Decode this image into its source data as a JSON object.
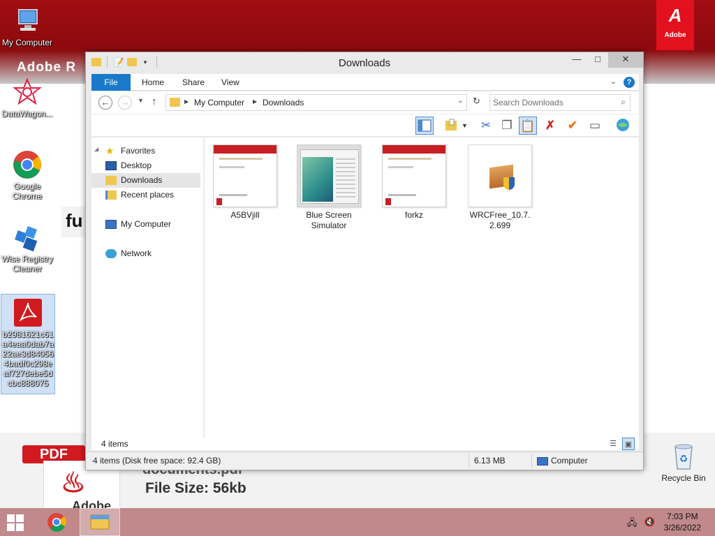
{
  "desktop": {
    "wallpaper": {
      "adobe_text": "Adobe R",
      "adobe_logo_text": "Adobe",
      "fu_text": "fu",
      "pdf_badge": "PDF",
      "pdf_doc_brand": "Adobe",
      "doc_name": "documents.pdf",
      "file_size": "File Size: 56kb"
    },
    "icons": [
      {
        "label": "My Computer"
      },
      {
        "label": "DataWagon..."
      },
      {
        "label": "Google Chrome"
      },
      {
        "label": "Wise Registry Cleaner"
      },
      {
        "label": "b2981621c61a4eaa0dab7a22ae3d840564badf0c298eaf727debe5dcbc888075"
      },
      {
        "label": "Recycle Bin"
      }
    ]
  },
  "window": {
    "title": "Downloads",
    "ribbon": {
      "tabs": [
        "File",
        "Home",
        "Share",
        "View"
      ]
    },
    "address": {
      "crumbs": [
        "My Computer",
        "Downloads"
      ]
    },
    "search": {
      "placeholder": "Search Downloads"
    },
    "nav": {
      "favorites": "Favorites",
      "desktop": "Desktop",
      "downloads": "Downloads",
      "recent": "Recent places",
      "computer": "My Computer",
      "network": "Network"
    },
    "files": [
      {
        "name": "A5BVjill",
        "type": "pdf"
      },
      {
        "name": "Blue Screen Simulator",
        "type": "app"
      },
      {
        "name": "forkz",
        "type": "pdf"
      },
      {
        "name": "WRCFree_10.7.2.699",
        "type": "installer"
      }
    ],
    "item_count": "4 items",
    "status": {
      "summary": "4 items (Disk free space: 92.4 GB)",
      "size": "6.13 MB",
      "location": "Computer"
    }
  },
  "taskbar": {
    "time": "7:03 PM",
    "date": "3/26/2022"
  },
  "colors": {
    "accent": "#1979ca",
    "wallpaper_red": "#a10d12",
    "taskbar": "#c1898b"
  }
}
